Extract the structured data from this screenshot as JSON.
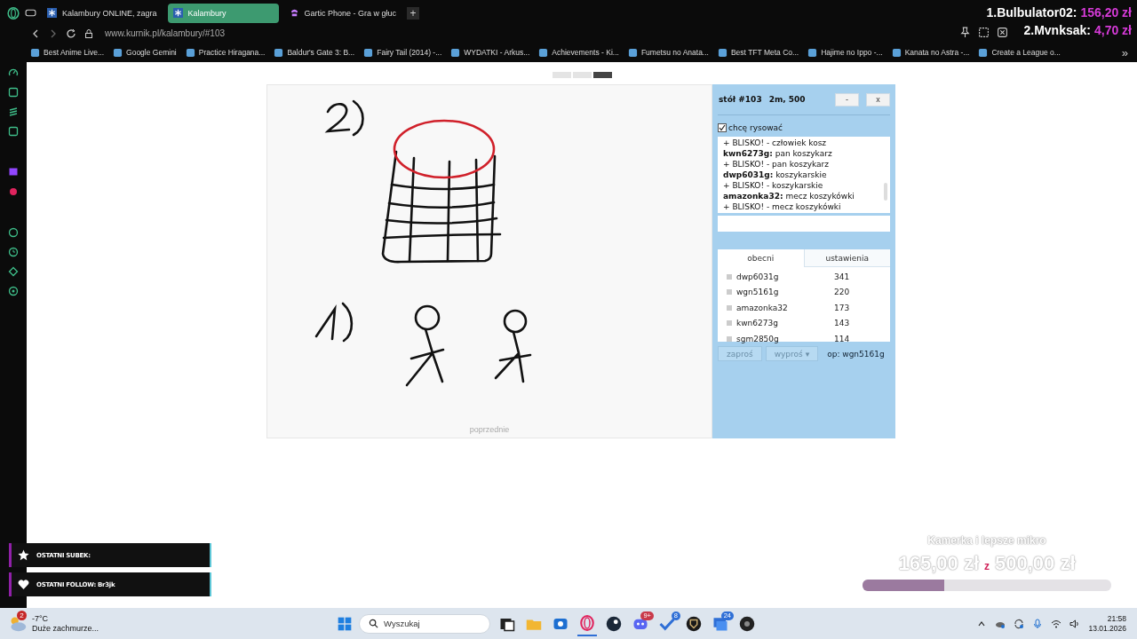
{
  "browser": {
    "tabs": [
      {
        "title": "Kalambury ONLINE, zagra",
        "selected": false
      },
      {
        "title": "Kalambury",
        "selected": true
      },
      {
        "title": "Gartic Phone - Gra w głuc",
        "selected": false
      }
    ],
    "new_tab": "+",
    "address": "www.kurnik.pl/kalambury/#103",
    "bookmarks": [
      "Best Anime Live...",
      "Google Gemini",
      "Practice Hiragana...",
      "Baldur's Gate 3: B...",
      "Fairy Tail (2014) -...",
      "WYDATKI - Arkus...",
      "Achievements - Ki...",
      "Fumetsu no Anata...",
      "Best TFT Meta Co...",
      "Hajime no Ippo -...",
      "Kanata no Astra -...",
      "Create a League o..."
    ],
    "more_bookmarks": "»"
  },
  "donors": [
    {
      "name": "1.Bulbulator02:",
      "amount": "156,20 zł"
    },
    {
      "name": "2.Mvnksak:",
      "amount": "4,70 zł"
    }
  ],
  "game": {
    "pager": [
      {
        "selected": false
      },
      {
        "selected": false
      },
      {
        "selected": true
      }
    ],
    "canvas": {
      "caption": "poprzednie"
    },
    "panel": {
      "table": "stół #103",
      "settings": "2m, 500",
      "minimize": "-",
      "close": "x",
      "want_to_draw": {
        "label": "chcę rysować",
        "checked": true
      },
      "chat": [
        {
          "kind": "close",
          "text": "+ BLISKO! - człowiek kosz"
        },
        {
          "kind": "guess",
          "user": "kwn6273g:",
          "text": "pan koszykarz"
        },
        {
          "kind": "close",
          "text": "+ BLISKO! - pan koszykarz"
        },
        {
          "kind": "guess",
          "user": "dwp6031g:",
          "text": "koszykarskie"
        },
        {
          "kind": "close",
          "text": "+ BLISKO! - koszykarskie"
        },
        {
          "kind": "guess",
          "user": "amazonka32:",
          "text": "mecz koszykówki"
        },
        {
          "kind": "close",
          "text": "+ BLISKO! - mecz koszykówki"
        }
      ],
      "tabs": [
        {
          "label": "obecni",
          "selected": true
        },
        {
          "label": "ustawienia",
          "selected": false
        }
      ],
      "players": [
        {
          "name": "dwp6031g",
          "score": "341"
        },
        {
          "name": "wgn5161g",
          "score": "220"
        },
        {
          "name": "amazonka32",
          "score": "173"
        },
        {
          "name": "kwn6273g",
          "score": "143"
        },
        {
          "name": "sgm2850g",
          "score": "114"
        }
      ],
      "invite": "zaproś",
      "kick": "wyproś",
      "kick_caret": "▾",
      "operator": "op: wgn5161g"
    }
  },
  "alerts": [
    {
      "kind": "sub",
      "text": "OSTATNI SUBEK:"
    },
    {
      "kind": "follow",
      "text": "OSTATNI FOLLOW: Br3jk"
    }
  ],
  "goal": {
    "title": "Kamerka i lepsze mikro",
    "current": "165,00 zł",
    "separator": "z",
    "target": "500,00 zł",
    "level": 0.33
  },
  "taskbar": {
    "weather": {
      "temp": "-7°C",
      "condition": "Duże zachmurze...",
      "badge": "2"
    },
    "search": "Wyszukaj",
    "apps": [
      {
        "kind": "taskview",
        "selected": false
      },
      {
        "kind": "folder",
        "selected": false
      },
      {
        "kind": "mail",
        "selected": false
      },
      {
        "kind": "browser",
        "selected": true
      },
      {
        "kind": "steam",
        "selected": false
      },
      {
        "kind": "discord",
        "selected": false,
        "badge": "9+"
      },
      {
        "kind": "check",
        "selected": false,
        "badge": "8"
      },
      {
        "kind": "league",
        "selected": false
      },
      {
        "kind": "chat",
        "selected": false,
        "badge": "24"
      },
      {
        "kind": "recorder",
        "selected": false
      }
    ],
    "time": "21:58",
    "date": "13.01.2026"
  }
}
